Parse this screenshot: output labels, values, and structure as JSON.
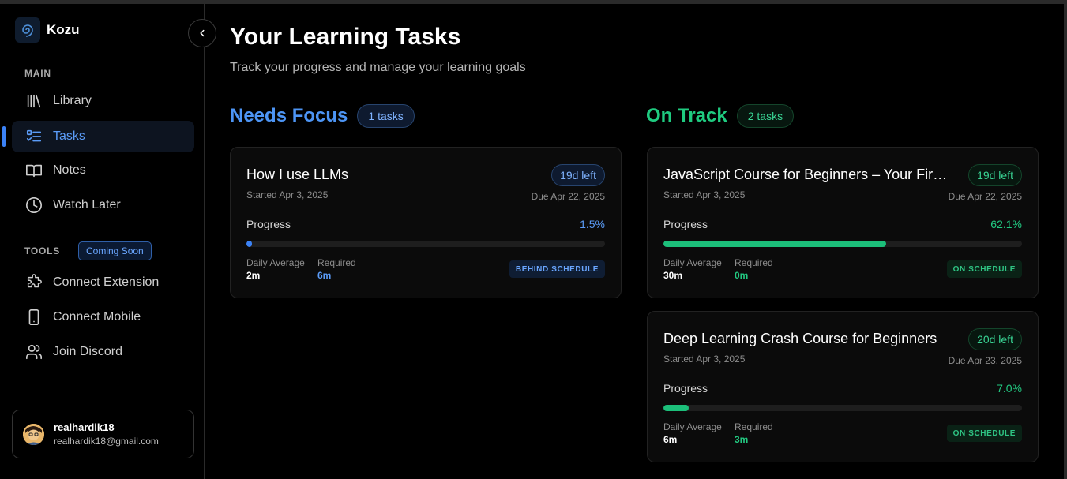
{
  "app": {
    "name": "Kozu"
  },
  "sidebar": {
    "main_label": "MAIN",
    "items": [
      {
        "label": "Library",
        "icon": "library-icon"
      },
      {
        "label": "Tasks",
        "icon": "tasks-icon",
        "active": true
      },
      {
        "label": "Notes",
        "icon": "book-icon"
      },
      {
        "label": "Watch Later",
        "icon": "clock-icon"
      }
    ],
    "tools_label": "TOOLS",
    "coming_soon": "Coming Soon",
    "tools": [
      {
        "label": "Connect Extension",
        "icon": "puzzle-icon"
      },
      {
        "label": "Connect Mobile",
        "icon": "phone-icon"
      },
      {
        "label": "Join Discord",
        "icon": "users-icon"
      }
    ]
  },
  "user": {
    "name": "realhardik18",
    "email": "realhardik18@gmail.com"
  },
  "page": {
    "title": "Your Learning Tasks",
    "subtitle": "Track your progress and manage your learning goals"
  },
  "columns": {
    "needs_focus": {
      "title": "Needs Focus",
      "count": "1 tasks",
      "color": "#4d95f5"
    },
    "on_track": {
      "title": "On Track",
      "count": "2 tasks",
      "color": "#1fcb80"
    }
  },
  "tasks": {
    "focus": [
      {
        "title": "How I use LLMs",
        "started": "Started Apr 3, 2025",
        "days_left": "19d left",
        "due": "Due Apr 22, 2025",
        "progress_label": "Progress",
        "progress_text": "1.5%",
        "progress": 0.015,
        "daily_label": "Daily Average",
        "daily_value": "2m",
        "required_label": "Required",
        "required_value": "6m",
        "status": "BEHIND SCHEDULE"
      }
    ],
    "on_track": [
      {
        "title": "JavaScript Course for Beginners – Your First Step to Web Development",
        "started": "Started Apr 3, 2025",
        "days_left": "19d left",
        "due": "Due Apr 22, 2025",
        "progress_label": "Progress",
        "progress_text": "62.1%",
        "progress": 0.621,
        "daily_label": "Daily Average",
        "daily_value": "30m",
        "required_label": "Required",
        "required_value": "0m",
        "status": "ON SCHEDULE"
      },
      {
        "title": "Deep Learning Crash Course for Beginners",
        "started": "Started Apr 3, 2025",
        "days_left": "20d left",
        "due": "Due Apr 23, 2025",
        "progress_label": "Progress",
        "progress_text": "7.0%",
        "progress": 0.07,
        "daily_label": "Daily Average",
        "daily_value": "6m",
        "required_label": "Required",
        "required_value": "3m",
        "status": "ON SCHEDULE"
      }
    ]
  }
}
